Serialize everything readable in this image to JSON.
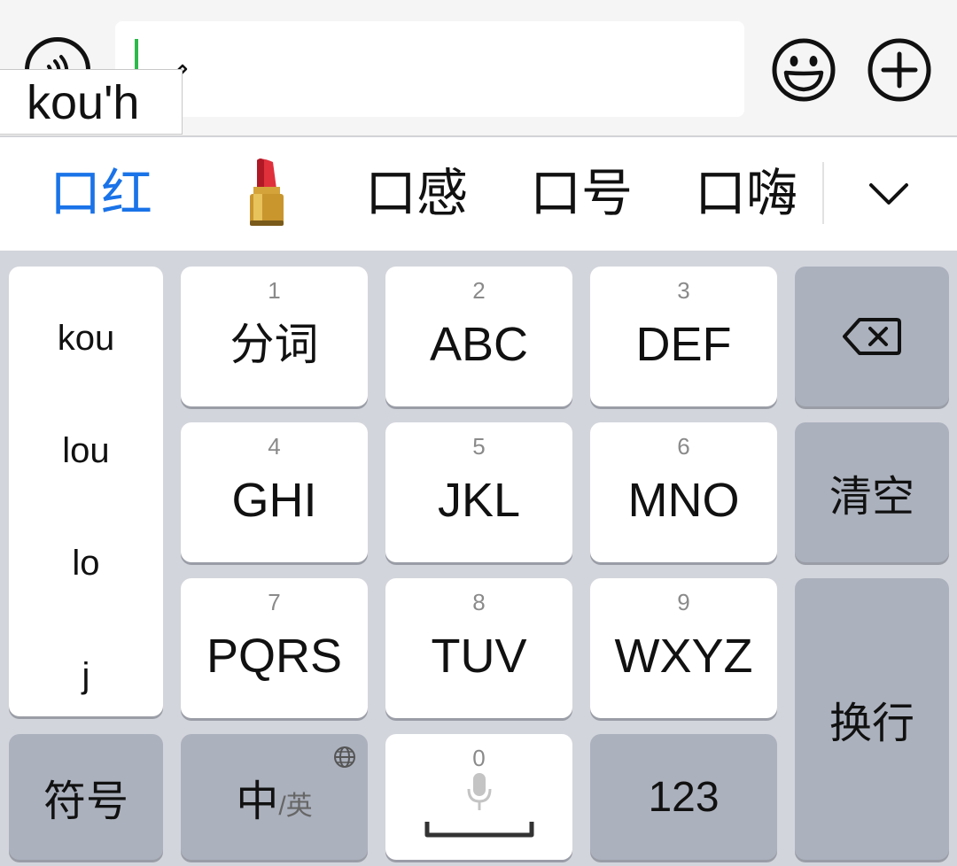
{
  "input_bar": {
    "composition_text": "kou'h"
  },
  "candidates": {
    "items": [
      "口红",
      "口感",
      "口号",
      "口嗨"
    ],
    "emoji_candidate": "lipstick"
  },
  "pinyin_options": [
    "kou",
    "lou",
    "lo",
    "j"
  ],
  "keys": {
    "k1": {
      "num": "1",
      "label": "分词"
    },
    "k2": {
      "num": "2",
      "label": "ABC"
    },
    "k3": {
      "num": "3",
      "label": "DEF"
    },
    "k4": {
      "num": "4",
      "label": "GHI"
    },
    "k5": {
      "num": "5",
      "label": "JKL"
    },
    "k6": {
      "num": "6",
      "label": "MNO"
    },
    "k7": {
      "num": "7",
      "label": "PQRS"
    },
    "k8": {
      "num": "8",
      "label": "TUV"
    },
    "k9": {
      "num": "9",
      "label": "WXYZ"
    },
    "k0": {
      "num": "0"
    },
    "clear": "清空",
    "enter": "换行",
    "symbols": "符号",
    "lang_main": "中",
    "lang_sub": "/英",
    "numbers": "123"
  },
  "colors": {
    "accent": "#1a73e8",
    "cursor": "#2db84b",
    "keyboard_bg": "#d3d5dc",
    "function_key": "#abb1bd"
  },
  "icons": [
    "voice-input-icon",
    "pencil-icon",
    "emoji-icon",
    "plus-icon",
    "chevron-down-icon",
    "backspace-icon",
    "globe-icon",
    "microphone-icon",
    "space-bar-icon"
  ]
}
